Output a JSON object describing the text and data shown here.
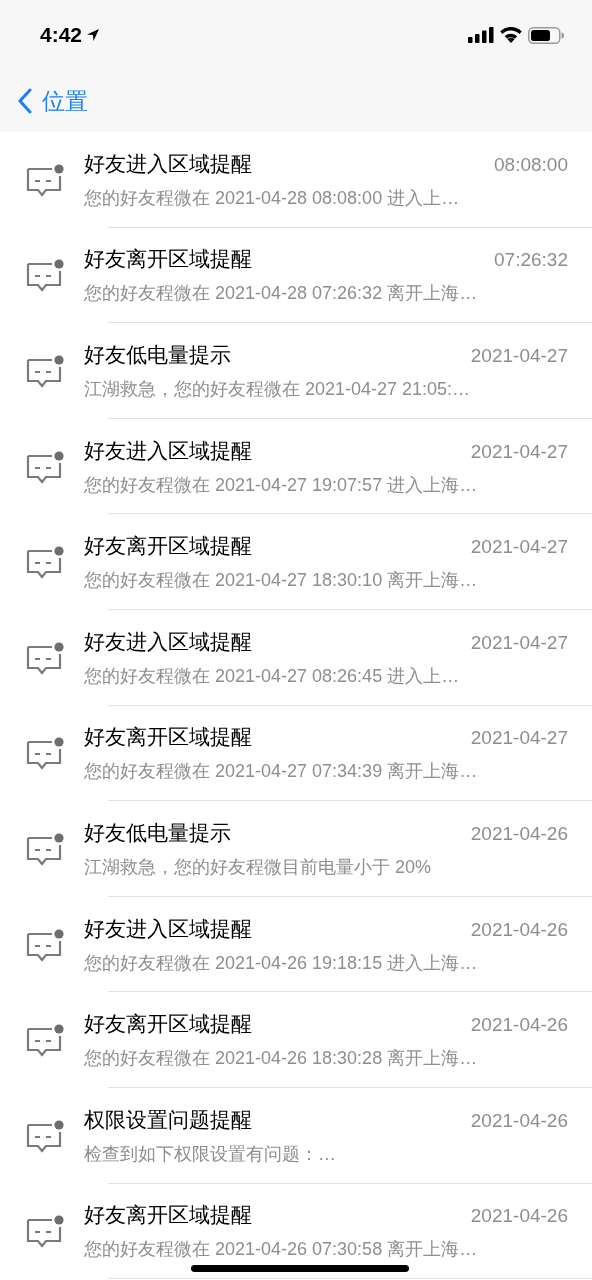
{
  "status_bar": {
    "time": "4:42"
  },
  "nav_bar": {
    "back_label": "位置"
  },
  "messages": [
    {
      "title": "好友进入区域提醒",
      "time": "08:08:00",
      "preview": "您的好友程微在 2021-04-28 08:08:00 进入上…"
    },
    {
      "title": "好友离开区域提醒",
      "time": "07:26:32",
      "preview": "您的好友程微在 2021-04-28 07:26:32 离开上海…"
    },
    {
      "title": "好友低电量提示",
      "time": "2021-04-27",
      "preview": "江湖救急，您的好友程微在 2021-04-27 21:05:…"
    },
    {
      "title": "好友进入区域提醒",
      "time": "2021-04-27",
      "preview": "您的好友程微在 2021-04-27 19:07:57 进入上海…"
    },
    {
      "title": "好友离开区域提醒",
      "time": "2021-04-27",
      "preview": "您的好友程微在 2021-04-27 18:30:10 离开上海…"
    },
    {
      "title": "好友进入区域提醒",
      "time": "2021-04-27",
      "preview": "您的好友程微在 2021-04-27 08:26:45 进入上…"
    },
    {
      "title": "好友离开区域提醒",
      "time": "2021-04-27",
      "preview": "您的好友程微在 2021-04-27 07:34:39 离开上海…"
    },
    {
      "title": "好友低电量提示",
      "time": "2021-04-26",
      "preview": "江湖救急，您的好友程微目前电量小于 20%"
    },
    {
      "title": "好友进入区域提醒",
      "time": "2021-04-26",
      "preview": "您的好友程微在 2021-04-26 19:18:15 进入上海…"
    },
    {
      "title": "好友离开区域提醒",
      "time": "2021-04-26",
      "preview": "您的好友程微在 2021-04-26 18:30:28 离开上海…"
    },
    {
      "title": "权限设置问题提醒",
      "time": "2021-04-26",
      "preview": "检查到如下权限设置有问题：…"
    },
    {
      "title": "好友离开区域提醒",
      "time": "2021-04-26",
      "preview": "您的好友程微在 2021-04-26 07:30:58 离开上海…"
    }
  ]
}
